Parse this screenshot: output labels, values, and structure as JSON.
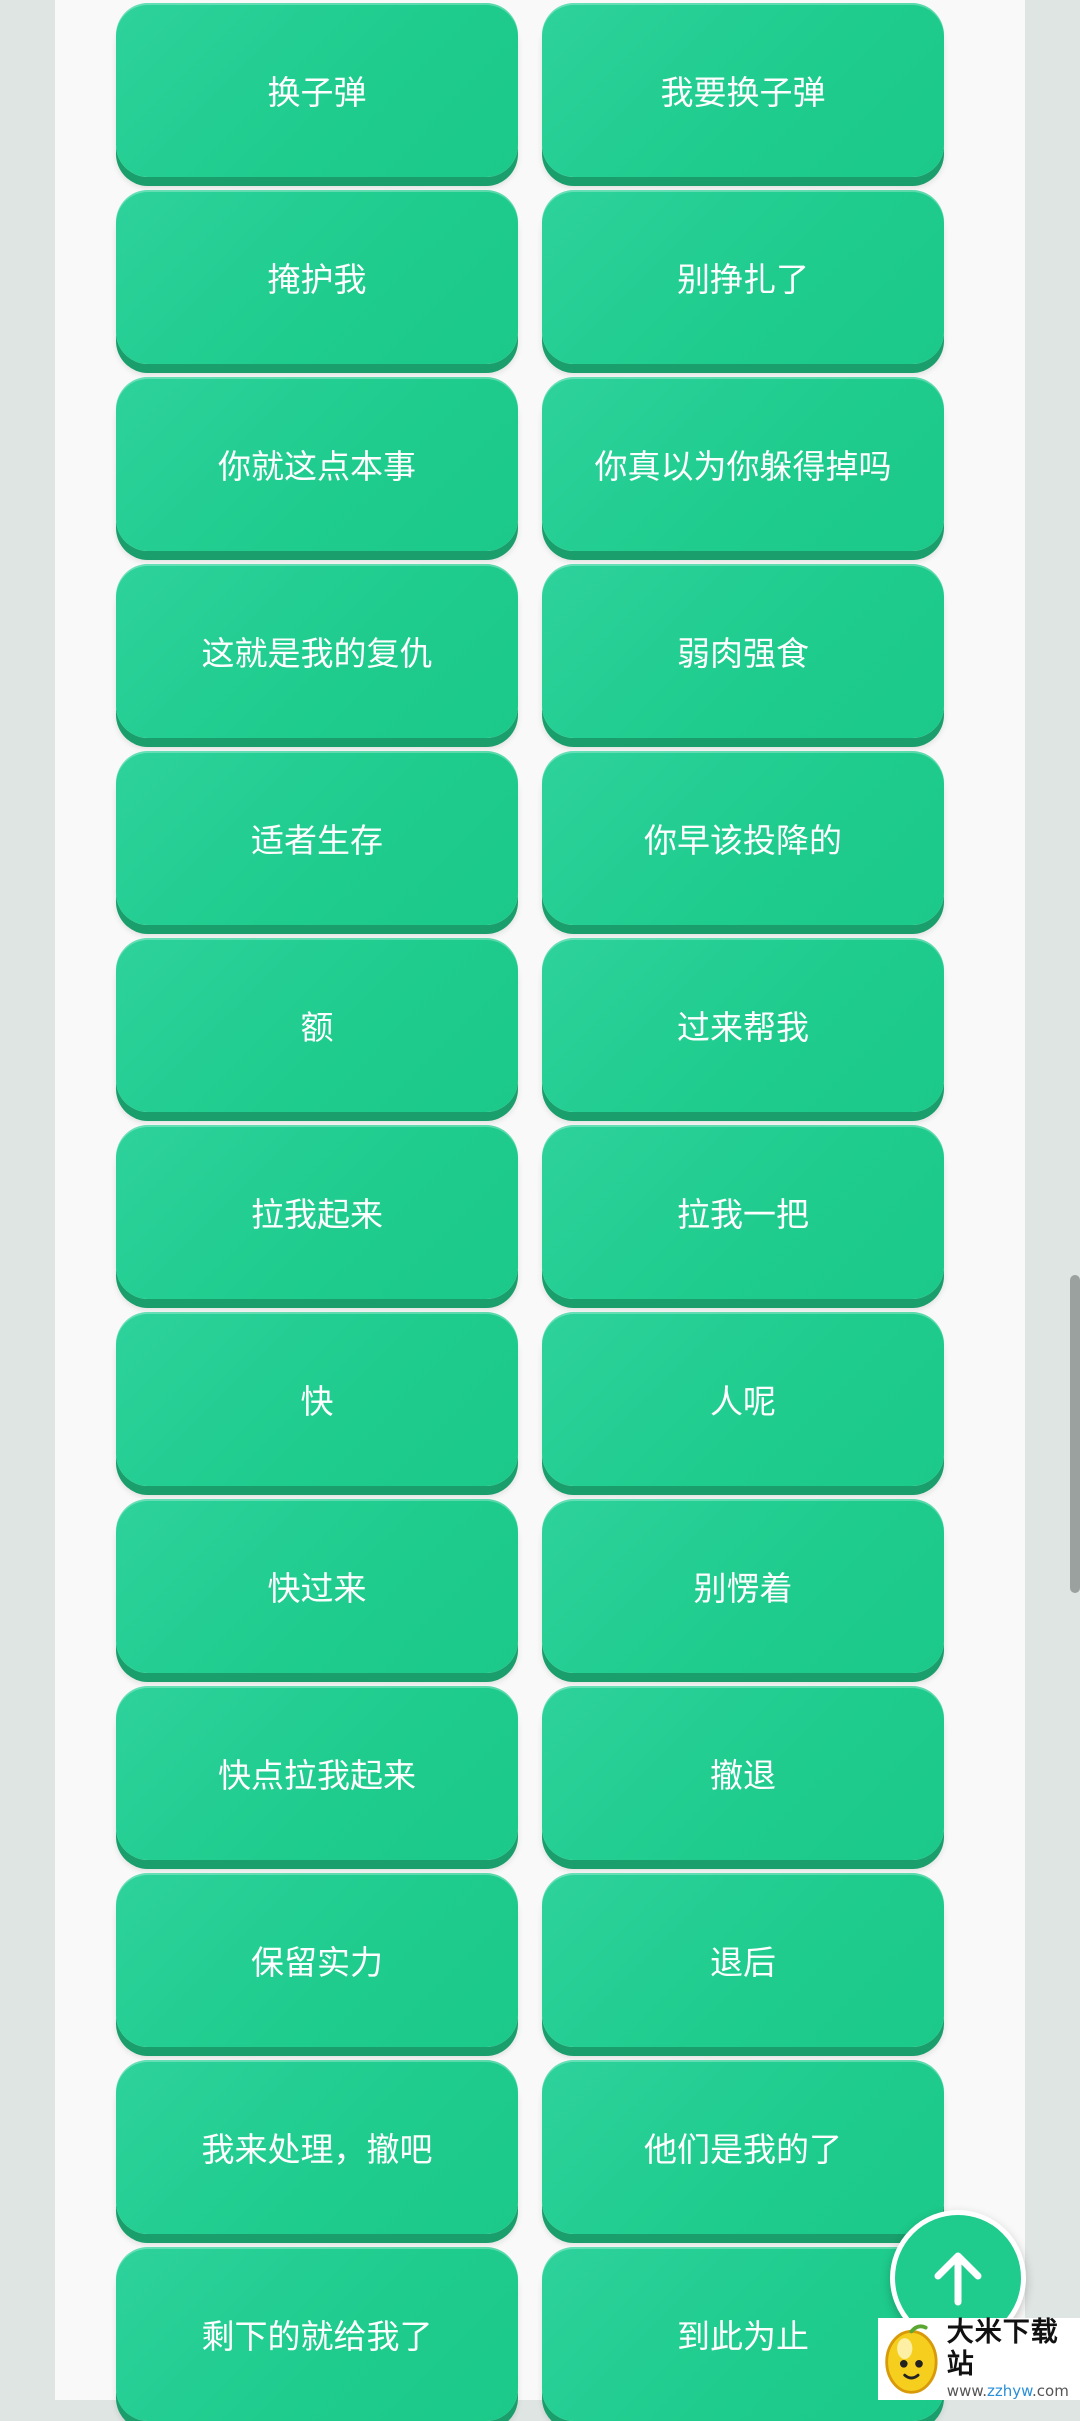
{
  "buttons": [
    "换子弹",
    "我要换子弹",
    "掩护我",
    "别挣扎了",
    "你就这点本事",
    "你真以为你躲得掉吗",
    "这就是我的复仇",
    "弱肉强食",
    "适者生存",
    "你早该投降的",
    "额",
    "过来帮我",
    "拉我起来",
    "拉我一把",
    "快",
    "人呢",
    "快过来",
    "别愣着",
    "快点拉我起来",
    "撤退",
    "保留实力",
    "退后",
    "我来处理，撤吧",
    "他们是我的了",
    "剩下的就给我了",
    "到此为止"
  ],
  "scroll_top_icon": "arrow-up-icon",
  "watermark": {
    "title": "大米下载站",
    "url_prefix": "www.",
    "url_highlight": "zzhyw",
    "url_suffix": ".com"
  },
  "colors": {
    "button": "#1fcc8e",
    "button_shadow": "#199e6c",
    "background": "#dfe5e2",
    "panel": "#f8f9f8"
  }
}
